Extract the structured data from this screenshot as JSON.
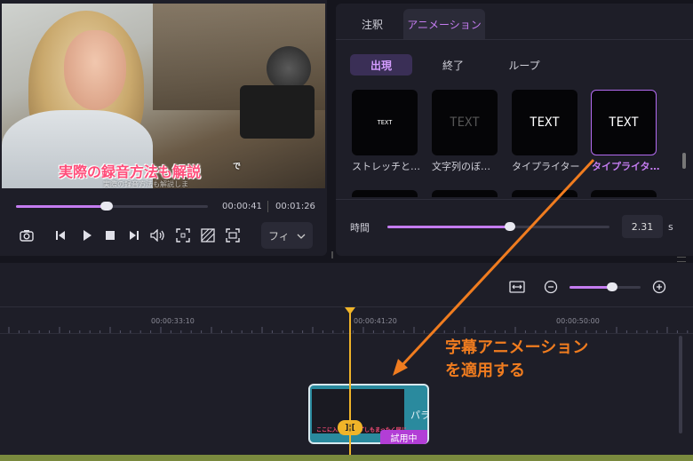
{
  "preview": {
    "subtitle_main": "実際の録音方法も解説",
    "subtitle_tail": "で",
    "subtitle_ghost": "実際の録音方法も解説しま",
    "current_time": "00:00:41",
    "total_time": "00:01:26",
    "progress": 0.47,
    "quality_label": "フィ",
    "controls": [
      "camera-icon",
      "prev-frame-icon",
      "play-icon",
      "stop-icon",
      "next-frame-icon",
      "volume-icon",
      "fullscreen-frame-icon",
      "safe-zone-icon",
      "crop-icon"
    ]
  },
  "panel": {
    "tabs": [
      "注釈",
      "アニメーション"
    ],
    "active_tab": "アニメーション",
    "subtabs": [
      "出現",
      "終了",
      "ループ"
    ],
    "active_subtab": "出現",
    "presets": [
      {
        "preview": "TEXT",
        "label": "ストレッチと…"
      },
      {
        "preview": "TEXT",
        "label": "文字列のぼ…"
      },
      {
        "preview": "TEXT",
        "label": "タイプライター"
      },
      {
        "preview": "TEXT",
        "label": "タイプライタ…",
        "selected": true
      }
    ],
    "duration_label": "時間",
    "duration_value": "2.31",
    "duration_unit": "s",
    "duration_fraction": 0.55
  },
  "timeline": {
    "ruler_labels": [
      "00:00:33:10",
      "00:00:41:20",
      "00:00:50:00"
    ],
    "clip_side_text": "パラ",
    "clip_badge": "試用中",
    "clip_thumb_text": "ここに入るのは必ずしもまったく同じ",
    "split_label": "]¦[",
    "zoom_fraction": 0.6
  },
  "annotation": {
    "line1": "字幕アニメーション",
    "line2": "を適用する",
    "color": "#f07c1f"
  },
  "colors": {
    "accent": "#c47cf0",
    "playhead": "#f0b429",
    "clip": "#2a8a9e"
  }
}
